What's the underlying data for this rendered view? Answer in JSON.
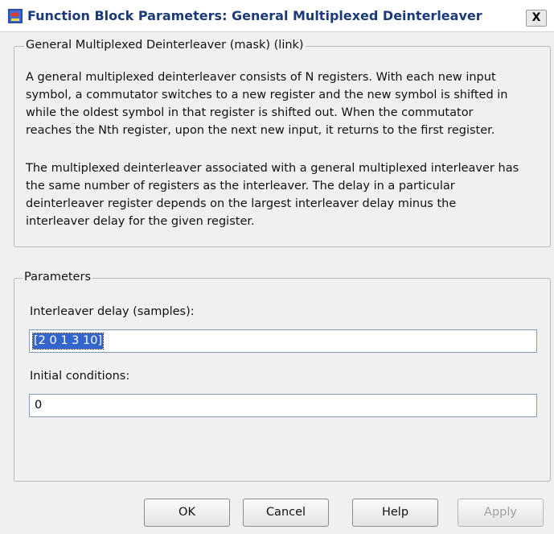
{
  "window": {
    "title": "Function Block Parameters: General Multiplexed Deinterleaver",
    "close_glyph": "X"
  },
  "description": {
    "legend": "General Multiplexed Deinterleaver (mask) (link)",
    "paragraph1_lines": [
      "A general multiplexed deinterleaver consists of N registers.  With each new input",
      "symbol, a commutator switches to a new register and the new symbol is shifted in",
      "while the oldest symbol in that register is shifted out.  When the commutator",
      "reaches the Nth register, upon the next new input, it returns to the first register."
    ],
    "paragraph2_lines": [
      "The multiplexed deinterleaver associated with a general multiplexed interleaver has",
      "the same number of registers as the interleaver.  The delay in a particular",
      "deinterleaver register depends on the largest interleaver delay minus the",
      "interleaver delay for the given register."
    ]
  },
  "parameters": {
    "legend": "Parameters",
    "interleaver_delay": {
      "label": "Interleaver delay (samples):",
      "value": "[2 0 1 3 10]"
    },
    "initial_conditions": {
      "label": "Initial conditions:",
      "value": "0"
    }
  },
  "buttons": {
    "ok": "OK",
    "cancel": "Cancel",
    "help": "Help",
    "apply": "Apply"
  }
}
